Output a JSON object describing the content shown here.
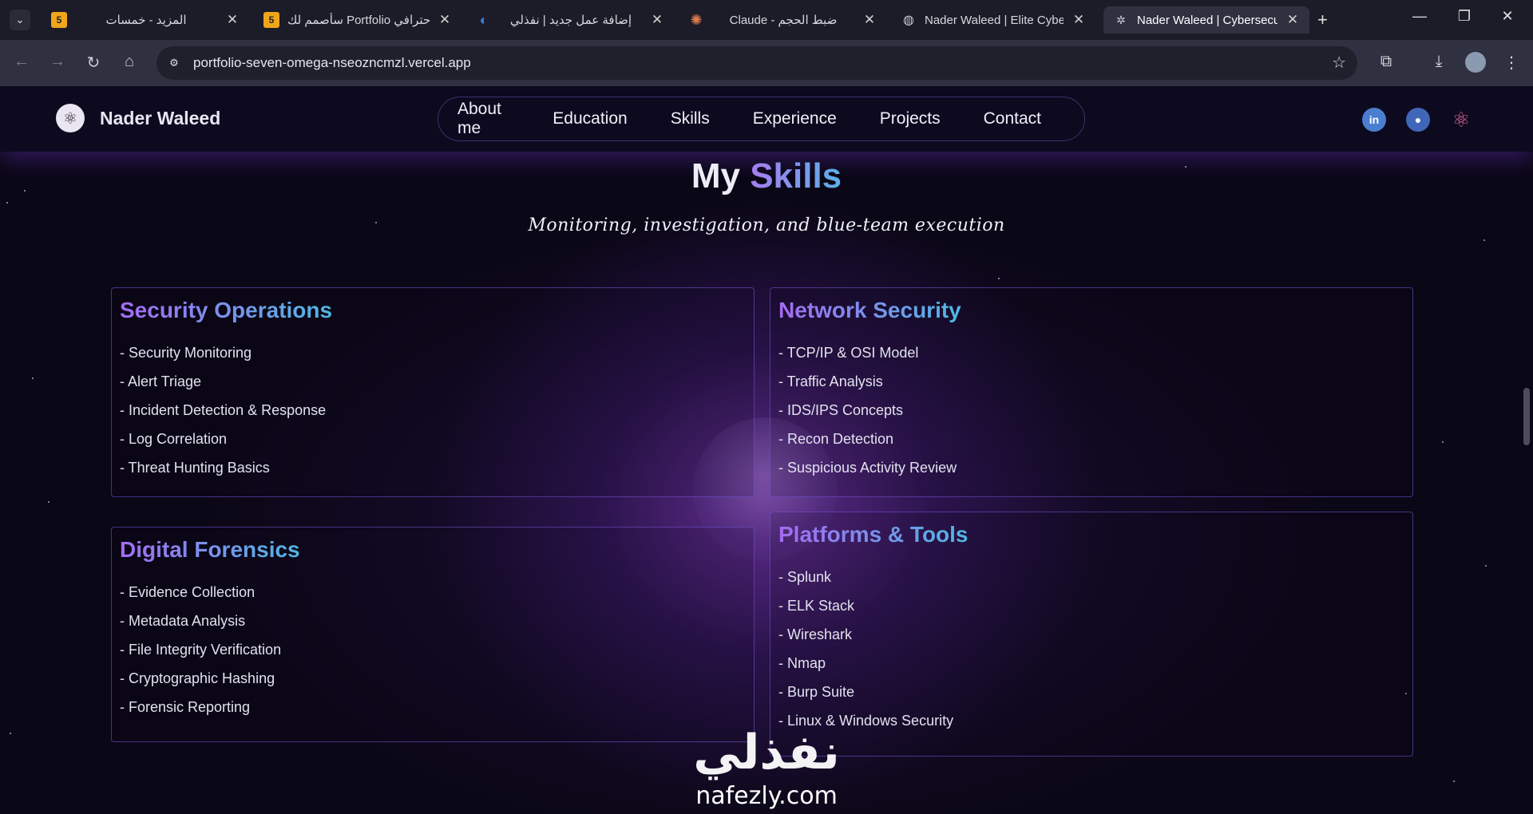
{
  "browser": {
    "tabs": [
      {
        "title": "المزيد - خمسات",
        "favicon": "5"
      },
      {
        "title": "سأصمم لك Portfolio احترافي",
        "favicon": "5"
      },
      {
        "title": "إضافة عمل جديد | نفذلي",
        "favicon": ""
      },
      {
        "title": "Claude - ضبط الحجم",
        "favicon": ""
      },
      {
        "title": "Nader Waleed | Elite Cyber",
        "favicon": ""
      },
      {
        "title": "Nader Waleed | Cybersecu",
        "favicon": ""
      }
    ],
    "url": "portfolio-seven-omega-nseozncmzl.vercel.app"
  },
  "site": {
    "brand": "Nader Waleed",
    "menu": [
      "About me",
      "Education",
      "Skills",
      "Experience",
      "Projects",
      "Contact"
    ],
    "social": {
      "linkedin": "in"
    }
  },
  "skills": {
    "title_plain": "My",
    "title_accent": "Skills",
    "subtitle": "Monitoring, investigation, and blue-team execution",
    "cards": [
      {
        "title": "Security Operations",
        "items": [
          "- Security Monitoring",
          "- Alert Triage",
          "- Incident Detection & Response",
          "- Log Correlation",
          "- Threat Hunting Basics"
        ]
      },
      {
        "title": "Network Security",
        "items": [
          "- TCP/IP & OSI Model",
          "- Traffic Analysis",
          "- IDS/IPS Concepts",
          "- Recon Detection",
          "- Suspicious Activity Review"
        ]
      },
      {
        "title": "Digital Forensics",
        "items": [
          "- Evidence Collection",
          "- Metadata Analysis",
          "- File Integrity Verification",
          "- Cryptographic Hashing",
          "- Forensic Reporting"
        ]
      },
      {
        "title": "Platforms & Tools",
        "items": [
          "- Splunk",
          "- ELK Stack",
          "- Wireshark",
          "- Nmap",
          "- Burp Suite",
          "- Linux & Windows Security"
        ]
      }
    ]
  },
  "watermark": {
    "arabic": "نفذلي",
    "latin": "nafezly.com"
  },
  "colors": {
    "accent_purple": "#a46bf2",
    "accent_blue": "#4fb7e3",
    "background": "#0a0716"
  },
  "icons": [
    "tab-search-icon",
    "back-icon",
    "forward-icon",
    "reload-icon",
    "home-icon",
    "site-info-icon",
    "star-icon",
    "extensions-icon",
    "download-icon",
    "menu-icon",
    "linkedin-icon",
    "github-icon",
    "react-icon"
  ]
}
